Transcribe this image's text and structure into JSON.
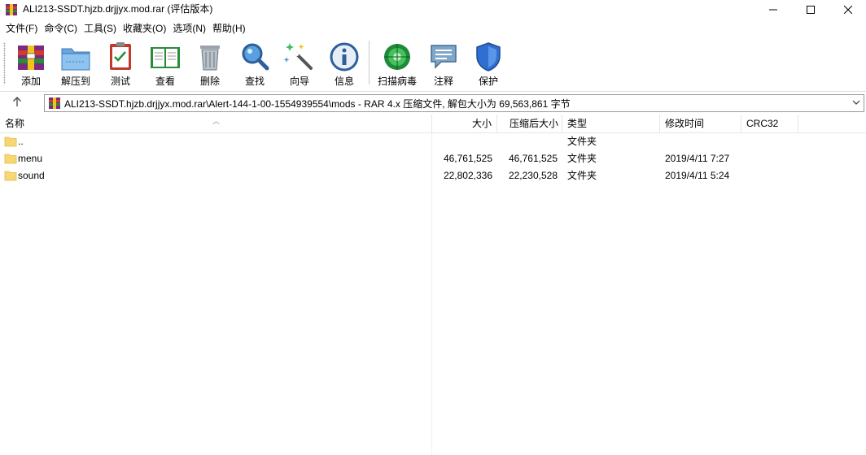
{
  "window": {
    "title": "ALI213-SSDT.hjzb.drjjyx.mod.rar (评估版本)",
    "app_icon": "winrar-icon"
  },
  "menu": {
    "items": [
      "文件(F)",
      "命令(C)",
      "工具(S)",
      "收藏夹(O)",
      "选项(N)",
      "帮助(H)"
    ]
  },
  "toolbar": {
    "buttons": [
      {
        "label": "添加",
        "icon": "add-archive-icon"
      },
      {
        "label": "解压到",
        "icon": "extract-to-icon"
      },
      {
        "label": "测试",
        "icon": "test-icon"
      },
      {
        "label": "查看",
        "icon": "view-icon"
      },
      {
        "label": "删除",
        "icon": "delete-icon"
      },
      {
        "label": "查找",
        "icon": "find-icon"
      },
      {
        "label": "向导",
        "icon": "wizard-icon"
      },
      {
        "label": "信息",
        "icon": "info-icon"
      },
      {
        "label": "扫描病毒",
        "icon": "virus-scan-icon"
      },
      {
        "label": "注释",
        "icon": "comment-icon"
      },
      {
        "label": "保护",
        "icon": "protect-icon"
      }
    ]
  },
  "address": {
    "path": "ALI213-SSDT.hjzb.drjjyx.mod.rar\\Alert-144-1-00-1554939554\\mods - RAR 4.x 压缩文件, 解包大小为 69,563,861 字节"
  },
  "columns": {
    "name": "名称",
    "size": "大小",
    "packed": "压缩后大小",
    "type": "类型",
    "modified": "修改时间",
    "crc": "CRC32"
  },
  "files": [
    {
      "name": "..",
      "size": "",
      "packed": "",
      "type": "文件夹",
      "modified": ""
    },
    {
      "name": "menu",
      "size": "46,761,525",
      "packed": "46,761,525",
      "type": "文件夹",
      "modified": "2019/4/11 7:27"
    },
    {
      "name": "sound",
      "size": "22,802,336",
      "packed": "22,230,528",
      "type": "文件夹",
      "modified": "2019/4/11 5:24"
    }
  ],
  "colors": {
    "folder": "#f7d774",
    "folder_edge": "#e0b84a",
    "accent": "#0078d7"
  }
}
